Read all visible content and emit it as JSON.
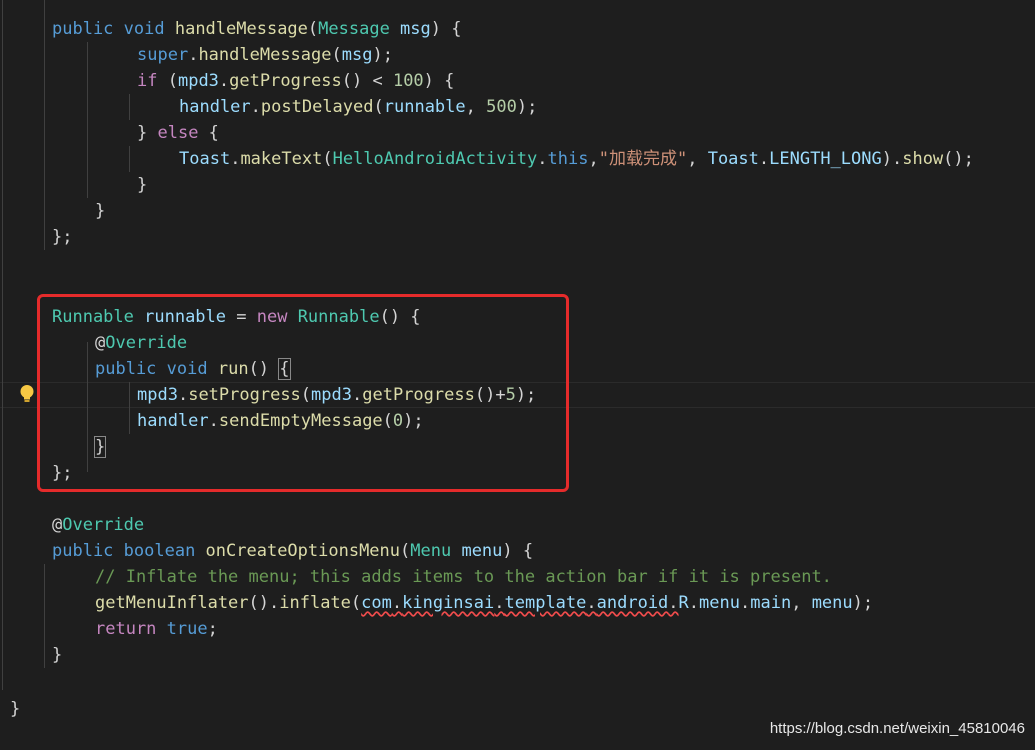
{
  "editor": {
    "lines": [
      [
        [
          "kw",
          "public "
        ],
        [
          "kw",
          "void "
        ],
        [
          "fn",
          "handleMessage"
        ],
        [
          "p",
          "("
        ],
        [
          "ty",
          "Message "
        ],
        [
          "var",
          "msg"
        ],
        [
          "p",
          ") {"
        ]
      ],
      [
        [
          "kw",
          "super"
        ],
        [
          "p",
          "."
        ],
        [
          "fn",
          "handleMessage"
        ],
        [
          "p",
          "("
        ],
        [
          "var",
          "msg"
        ],
        [
          "p",
          ");"
        ]
      ],
      [
        [
          "kwp",
          "if "
        ],
        [
          "p",
          "("
        ],
        [
          "var",
          "mpd3"
        ],
        [
          "p",
          "."
        ],
        [
          "fn",
          "getProgress"
        ],
        [
          "p",
          "() < "
        ],
        [
          "num",
          "100"
        ],
        [
          "p",
          ") {"
        ]
      ],
      [
        [
          "var",
          "handler"
        ],
        [
          "p",
          "."
        ],
        [
          "fn",
          "postDelayed"
        ],
        [
          "p",
          "("
        ],
        [
          "var",
          "runnable"
        ],
        [
          "p",
          ", "
        ],
        [
          "num",
          "500"
        ],
        [
          "p",
          ");"
        ]
      ],
      [
        [
          "p",
          "} "
        ],
        [
          "kwp",
          "else "
        ],
        [
          "p",
          "{"
        ]
      ],
      [
        [
          "var",
          "Toast"
        ],
        [
          "p",
          "."
        ],
        [
          "fn",
          "makeText"
        ],
        [
          "p",
          "("
        ],
        [
          "ty",
          "HelloAndroidActivity"
        ],
        [
          "p",
          "."
        ],
        [
          "kw",
          "this"
        ],
        [
          "p",
          ","
        ],
        [
          "str",
          "\"加载完成\""
        ],
        [
          "p",
          ", "
        ],
        [
          "var",
          "Toast"
        ],
        [
          "p",
          "."
        ],
        [
          "var",
          "LENGTH_LONG"
        ],
        [
          "p",
          ")."
        ],
        [
          "fn",
          "show"
        ],
        [
          "p",
          "();"
        ]
      ],
      [
        [
          "p",
          "}"
        ]
      ],
      [
        [
          "p",
          "}"
        ]
      ],
      [
        [
          "p",
          "};"
        ]
      ],
      [],
      [],
      [
        [
          "ty",
          "Runnable "
        ],
        [
          "var",
          "runnable"
        ],
        [
          "p",
          " = "
        ],
        [
          "kwp",
          "new "
        ],
        [
          "ty",
          "Runnable"
        ],
        [
          "p",
          "() {"
        ]
      ],
      [
        [
          "ann-at",
          "@"
        ],
        [
          "ann",
          "Override"
        ]
      ],
      [
        [
          "kw",
          "public "
        ],
        [
          "kw",
          "void "
        ],
        [
          "fn",
          "run"
        ],
        [
          "p",
          "() "
        ],
        [
          "bm",
          "{"
        ]
      ],
      [
        [
          "var",
          "mpd3"
        ],
        [
          "p",
          "."
        ],
        [
          "fn",
          "setProgress"
        ],
        [
          "p",
          "("
        ],
        [
          "var",
          "mpd3"
        ],
        [
          "p",
          "."
        ],
        [
          "fn",
          "getProgress"
        ],
        [
          "p",
          "()+"
        ],
        [
          "num",
          "5"
        ],
        [
          "p",
          ");"
        ]
      ],
      [
        [
          "var",
          "handler"
        ],
        [
          "p",
          "."
        ],
        [
          "fn",
          "sendEmptyMessage"
        ],
        [
          "p",
          "("
        ],
        [
          "num",
          "0"
        ],
        [
          "p",
          ");"
        ]
      ],
      [
        [
          "bm",
          "}"
        ]
      ],
      [
        [
          "p",
          "};"
        ]
      ],
      [],
      [
        [
          "ann-at",
          "@"
        ],
        [
          "ann",
          "Override"
        ]
      ],
      [
        [
          "kw",
          "public "
        ],
        [
          "kw",
          "boolean "
        ],
        [
          "fn",
          "onCreateOptionsMenu"
        ],
        [
          "p",
          "("
        ],
        [
          "ty",
          "Menu "
        ],
        [
          "var",
          "menu"
        ],
        [
          "p",
          ") {"
        ]
      ],
      [
        [
          "cm",
          "// Inflate the menu; this adds items to the action bar if it is present."
        ]
      ],
      [
        [
          "fn",
          "getMenuInflater"
        ],
        [
          "p",
          "()."
        ],
        [
          "fn",
          "inflate"
        ],
        [
          "p",
          "("
        ],
        [
          "err-var",
          "com"
        ],
        [
          "err-p",
          "."
        ],
        [
          "err-var",
          "kinginsai"
        ],
        [
          "err-p",
          "."
        ],
        [
          "err-var",
          "template"
        ],
        [
          "err-p",
          "."
        ],
        [
          "err-var",
          "android"
        ],
        [
          "err-p",
          "."
        ],
        [
          "var",
          "R"
        ],
        [
          "p",
          "."
        ],
        [
          "var",
          "menu"
        ],
        [
          "p",
          "."
        ],
        [
          "var",
          "main"
        ],
        [
          "p",
          ", "
        ],
        [
          "var",
          "menu"
        ],
        [
          "p",
          ");"
        ]
      ],
      [
        [
          "kwp",
          "return "
        ],
        [
          "kw",
          "true"
        ],
        [
          "p",
          ";"
        ]
      ],
      [
        [
          "p",
          "}"
        ]
      ],
      [],
      [],
      [
        [
          "p",
          "}"
        ]
      ]
    ]
  },
  "watermark": "https://blog.csdn.net/weixin_45810046",
  "icons": {
    "lightbulb": "lightbulb-icon"
  },
  "colors": {
    "highlight_box": "#e52b2b",
    "background": "#1e1e1e"
  }
}
